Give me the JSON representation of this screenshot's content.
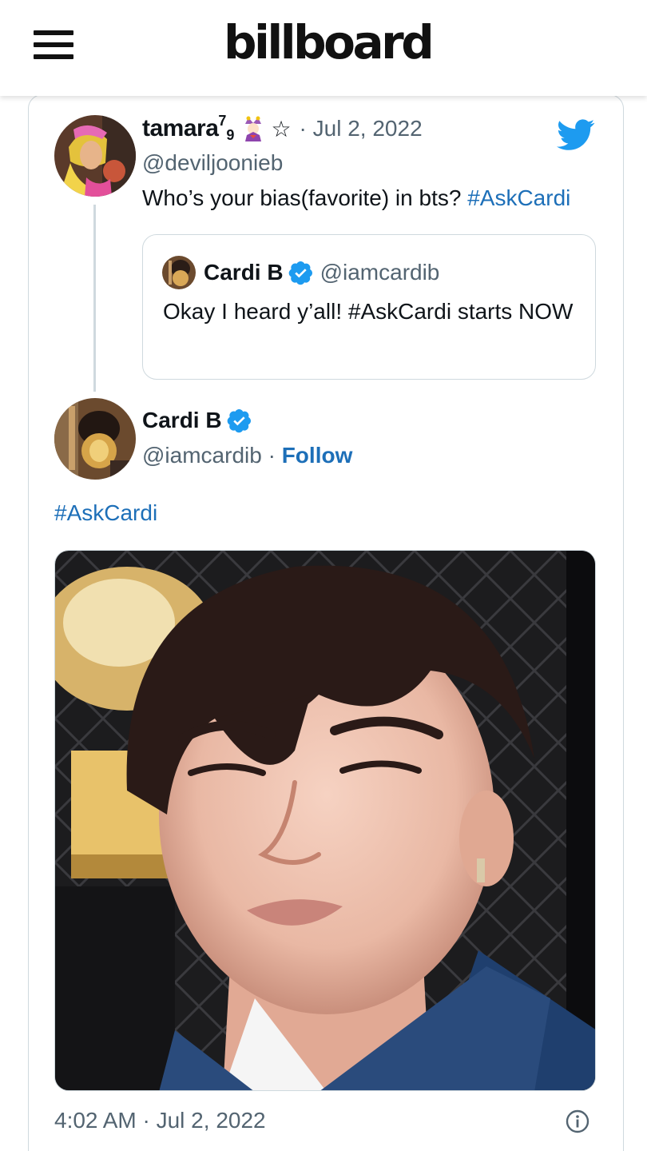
{
  "header": {
    "logo": "billboard",
    "menu_icon": "hamburger-menu-icon"
  },
  "tweet_reply": {
    "display_name": "tamara",
    "name_superscript": "7",
    "name_subscript": "9",
    "emoji": "jester-emoji",
    "star": "☆",
    "date": "· Jul 2, 2022",
    "handle": "@deviljoonieb",
    "text_before": "Who’s your bias(favorite) in bts? ",
    "text_hashtag": "#AskCardi"
  },
  "quoted_tweet": {
    "display_name": "Cardi B",
    "handle": "@iamcardib",
    "text": "Okay I heard y’all! #AskCardi  starts NOW"
  },
  "main_tweet": {
    "display_name": "Cardi B",
    "handle": "@iamcardib",
    "separator": " · ",
    "follow_label": "Follow",
    "hashtag": "#AskCardi",
    "timestamp": "4:02 AM · Jul 2, 2022"
  },
  "colors": {
    "link": "#1d6fb8",
    "twitter_blue": "#1d9bf0",
    "muted": "#536471",
    "border": "#cfd9de"
  }
}
